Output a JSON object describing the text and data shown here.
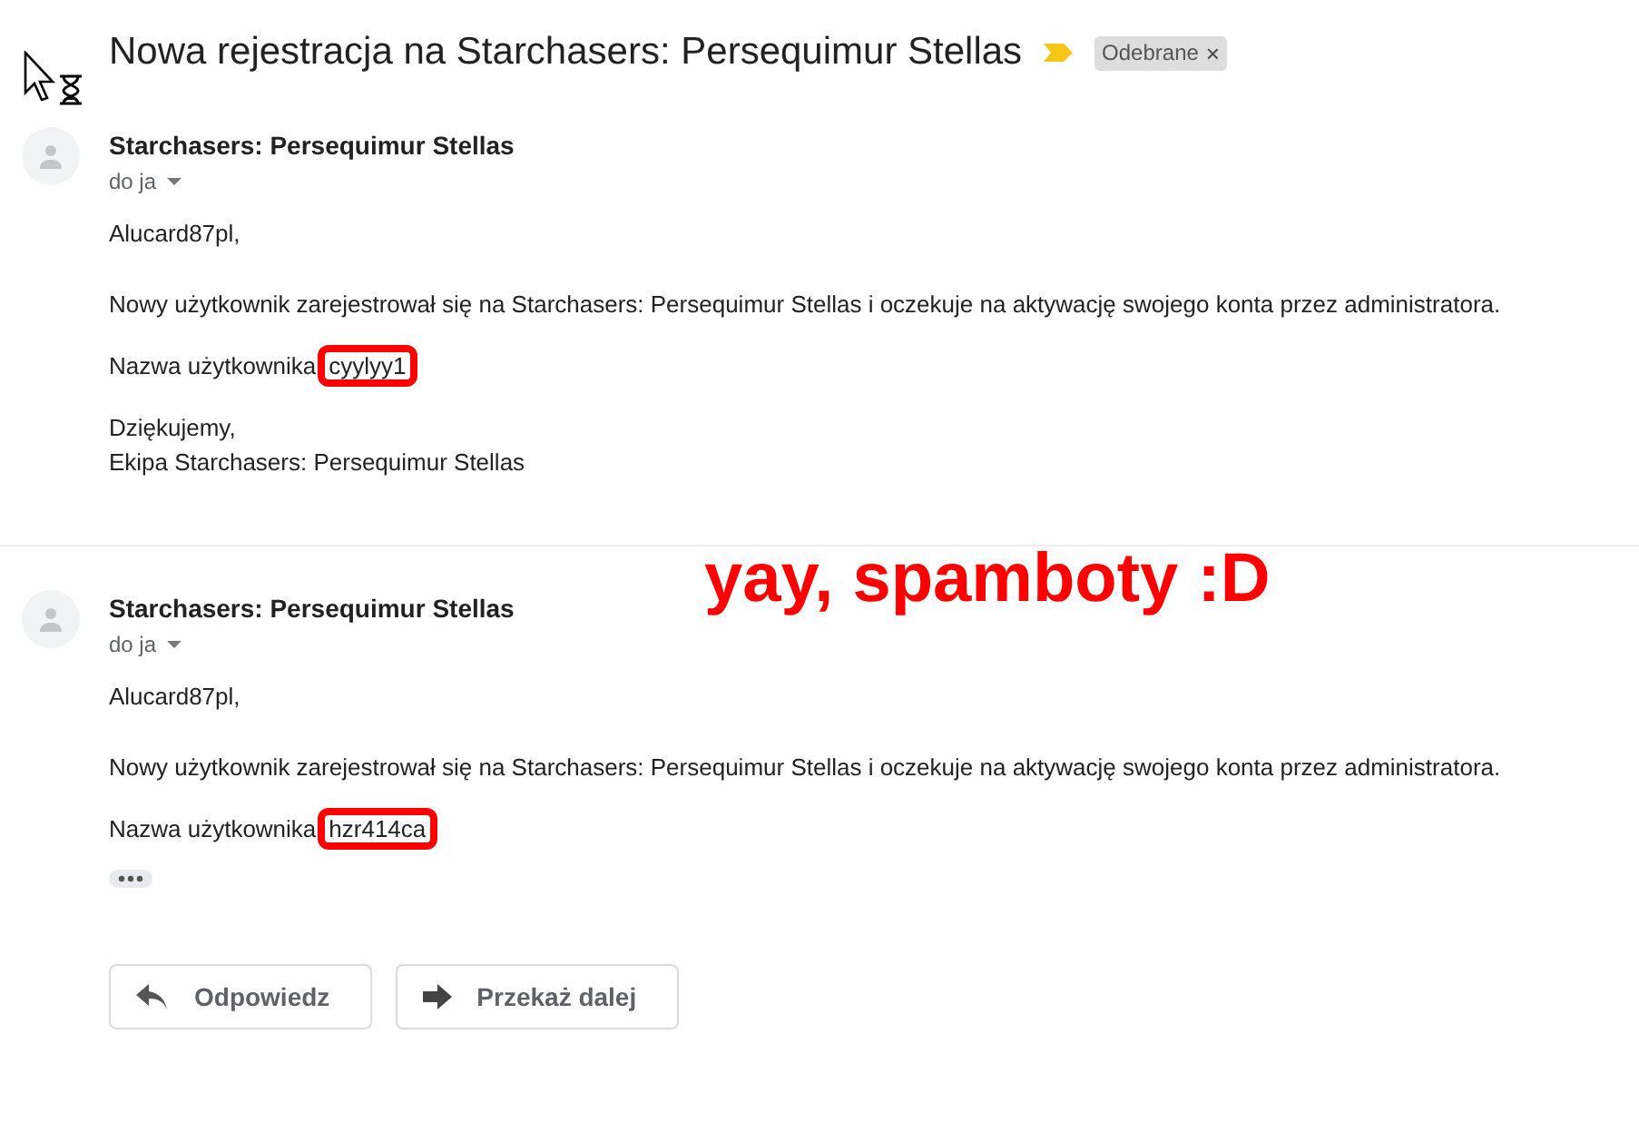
{
  "subject": "Nowa rejestracja na Starchasers: Persequimur Stellas",
  "label": {
    "text": "Odebrane",
    "close": "×"
  },
  "messages": [
    {
      "sender": "Starchasers: Persequimur Stellas",
      "recipient": "do ja",
      "greeting": "Alucard87pl,",
      "body": "Nowy użytkownik zarejestrował się na Starchasers: Persequimur Stellas i oczekuje na aktywację swojego konta przez administratora.",
      "username_label": "Nazwa użytkownika",
      "username": "cyylyy1",
      "closing": [
        "Dziękujemy,",
        "Ekipa Starchasers: Persequimur Stellas"
      ],
      "trimmed": false
    },
    {
      "sender": "Starchasers: Persequimur Stellas",
      "recipient": "do ja",
      "greeting": "Alucard87pl,",
      "body": "Nowy użytkownik zarejestrował się na Starchasers: Persequimur Stellas i oczekuje na aktywację swojego konta przez administratora.",
      "username_label": "Nazwa użytkownika",
      "username": "hzr414ca",
      "trimmed": true
    }
  ],
  "annotation": "yay, spamboty :D",
  "actions": [
    {
      "kind": "reply",
      "label": "Odpowiedz"
    },
    {
      "kind": "forward",
      "label": "Przekaż dalej"
    }
  ]
}
